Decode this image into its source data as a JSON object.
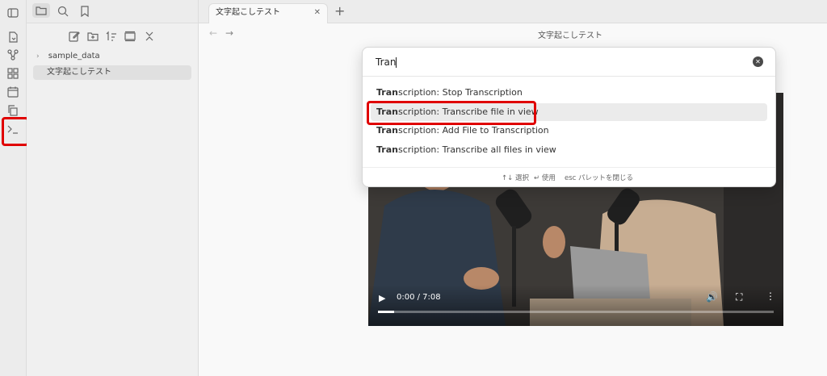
{
  "tab": {
    "title": "文字起こしテスト",
    "close": "✕",
    "new": "+"
  },
  "view_header": {
    "title": "文字起こしテスト"
  },
  "sidebar": {
    "folders": [
      {
        "label": "sample_data"
      }
    ],
    "files": [
      {
        "label": "文字起こしテスト"
      }
    ]
  },
  "palette": {
    "query": "Tran",
    "suggestions": [
      {
        "prefix": "Tran",
        "rest": "scription: Stop Transcription"
      },
      {
        "prefix": "Tran",
        "rest": "scription: Transcribe file in view"
      },
      {
        "prefix": "Tran",
        "rest": "scription: Add File to Transcription"
      },
      {
        "prefix": "Tran",
        "rest": "scription: Transcribe all files in view"
      }
    ],
    "selected_index": 1,
    "hints": {
      "navigate_key": "↑↓",
      "navigate": "選択",
      "use_key": "↵",
      "use": "使用",
      "close_key": "esc",
      "close": "パレットを閉じる"
    }
  },
  "video": {
    "time": "0:00 / 7:08",
    "progress": 0.04
  },
  "colors": {
    "highlight": "#e00000",
    "accent": "#8a5cf5"
  },
  "icons": {
    "ribbon": [
      "sidebar-toggle-icon",
      "file-open-icon",
      "graph-icon",
      "canvas-icon",
      "calendar-icon",
      "copy-icon",
      "terminal-icon"
    ],
    "sidebar_toolbar": [
      "folder-icon",
      "search-icon",
      "bookmark-icon",
      "new-note-icon",
      "new-folder-icon",
      "sort-icon",
      "collapse-icon",
      "expand-icon"
    ]
  }
}
